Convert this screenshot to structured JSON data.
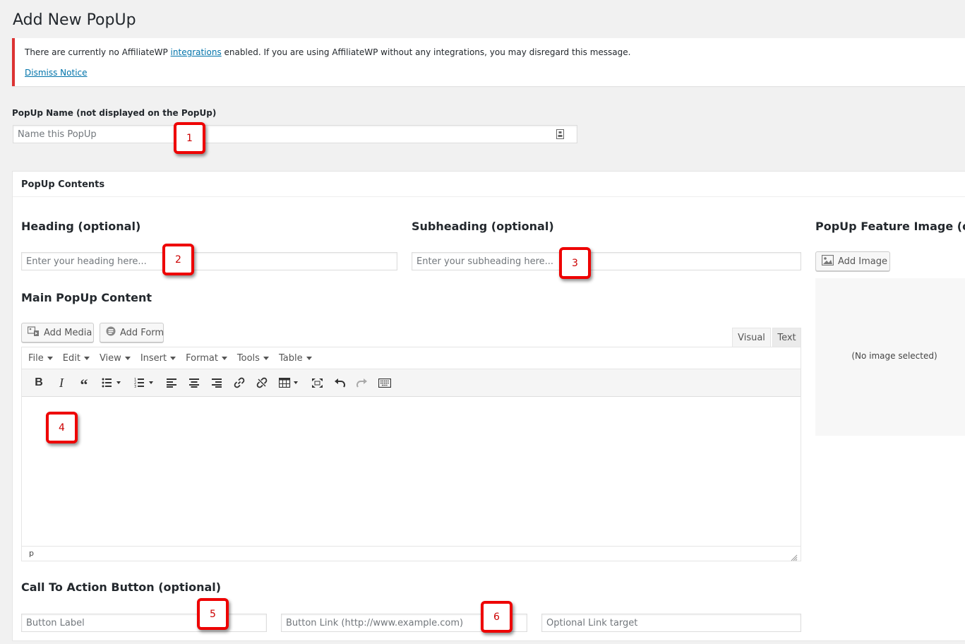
{
  "page": {
    "title": "Add New PopUp"
  },
  "notice": {
    "text_before": "There are currently no AffiliateWP ",
    "link": "integrations",
    "text_after": " enabled. If you are using AffiliateWP without any integrations, you may disregard this message.",
    "dismiss": "Dismiss Notice"
  },
  "name_field": {
    "label": "PopUp Name (not displayed on the PopUp)",
    "placeholder": "Name this PopUp"
  },
  "contents": {
    "title": "PopUp Contents",
    "heading": {
      "label": "Heading (optional)",
      "placeholder": "Enter your heading here..."
    },
    "subheading": {
      "label": "Subheading (optional)",
      "placeholder": "Enter your subheading here..."
    },
    "feature_image": {
      "label": "PopUp Feature Image (optic",
      "add_button": "Add Image",
      "empty": "(No image selected)"
    },
    "main_content": {
      "label": "Main PopUp Content",
      "add_media": "Add Media",
      "add_form": "Add Form",
      "tabs": [
        "Visual",
        "Text"
      ],
      "menu": [
        "File",
        "Edit",
        "View",
        "Insert",
        "Format",
        "Tools",
        "Table"
      ],
      "status_path": "p"
    },
    "cta": {
      "label": "Call To Action Button (optional)",
      "button_label_placeholder": "Button Label",
      "button_link_placeholder": "Button Link (http://www.example.com)",
      "link_target_placeholder": "Optional Link target"
    }
  },
  "markers": [
    "1",
    "2",
    "3",
    "4",
    "5",
    "6"
  ],
  "colors": {
    "notice_border": "#dc3232",
    "link": "#0073aa",
    "marker_border": "#ee0000"
  }
}
